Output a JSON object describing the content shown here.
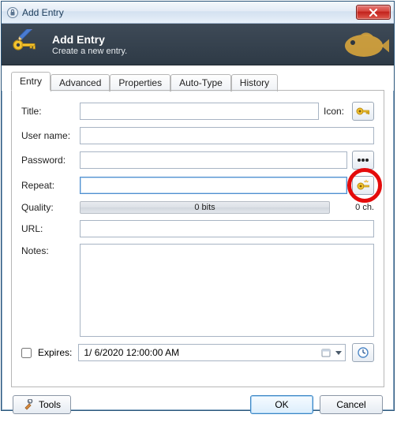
{
  "window": {
    "title": "Add Entry"
  },
  "banner": {
    "title": "Add Entry",
    "subtitle": "Create a new entry."
  },
  "tabs": [
    {
      "label": "Entry"
    },
    {
      "label": "Advanced"
    },
    {
      "label": "Properties"
    },
    {
      "label": "Auto-Type"
    },
    {
      "label": "History"
    }
  ],
  "labels": {
    "title": "Title:",
    "icon": "Icon:",
    "username": "User name:",
    "password": "Password:",
    "repeat": "Repeat:",
    "quality": "Quality:",
    "url": "URL:",
    "notes": "Notes:",
    "expires": "Expires:"
  },
  "values": {
    "title": "",
    "username": "",
    "password": "",
    "repeat": "",
    "url": "",
    "notes": "",
    "expires": "1/ 6/2020 12:00:00 AM"
  },
  "quality": {
    "bits": "0 bits",
    "chars": "0 ch."
  },
  "footer": {
    "tools": "Tools",
    "ok": "OK",
    "cancel": "Cancel"
  }
}
